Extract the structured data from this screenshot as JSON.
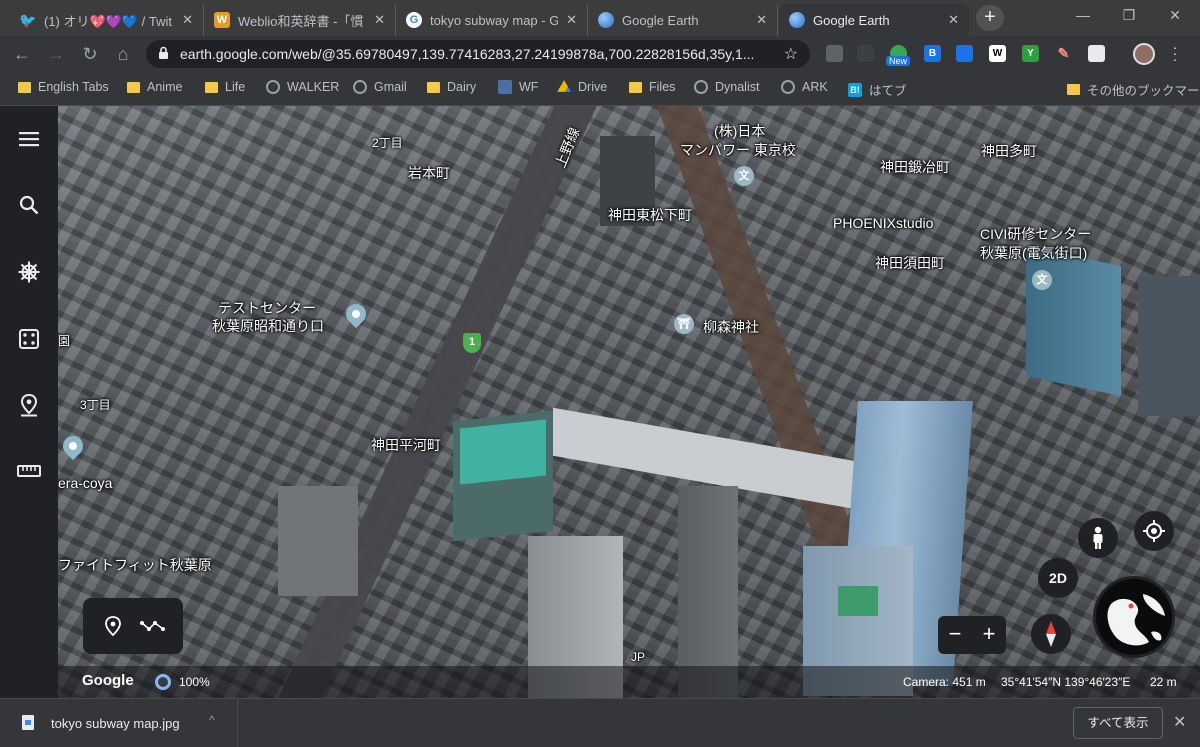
{
  "tabs": [
    {
      "title": "(1) オリ💖💜💙 / Twit",
      "favicon": "twitter-icon",
      "color": "#1da1f2",
      "glyph": "🐦"
    },
    {
      "title": "Weblio和英辞書 -「慣",
      "favicon": "weblio-icon",
      "color": "#e69a28",
      "glyph": "W"
    },
    {
      "title": "tokyo subway map - G",
      "favicon": "google-icon",
      "color": "#ffffff",
      "glyph": "G"
    },
    {
      "title": "Google Earth",
      "favicon": "google-earth-icon",
      "color": "#4a8bd6",
      "glyph": ""
    },
    {
      "title": "Google Earth",
      "favicon": "google-earth-icon",
      "color": "#4a8bd6",
      "glyph": "",
      "active": true
    }
  ],
  "tab_close": "✕",
  "new_tab": "+",
  "window_controls": {
    "minimize": "—",
    "maximize": "❐",
    "close": "✕"
  },
  "toolbar": {
    "back": "←",
    "forward": "→",
    "reload": "↻",
    "home": "⌂",
    "url": "earth.google.com/web/@35.69780497,139.77416283,27.24199878a,700.22828156d,35y,1...",
    "star": "☆",
    "new_badge": "New",
    "ext_b": "B",
    "ext_w": "W",
    "ext_y": "Y"
  },
  "bookmarks": [
    {
      "label": "English Tabs",
      "icon": "folder"
    },
    {
      "label": "Anime",
      "icon": "folder"
    },
    {
      "label": "Life",
      "icon": "folder"
    },
    {
      "label": "WALKER",
      "icon": "globe"
    },
    {
      "label": "Gmail",
      "icon": "globe"
    },
    {
      "label": "Dairy",
      "icon": "folder"
    },
    {
      "label": "WF",
      "icon": "wf"
    },
    {
      "label": "Drive",
      "icon": "drive"
    },
    {
      "label": "Files",
      "icon": "folder"
    },
    {
      "label": "Dynalist",
      "icon": "globe"
    },
    {
      "label": "ARK",
      "icon": "globe"
    },
    {
      "label": "はてブ",
      "icon": "hatena"
    },
    {
      "label": "その他のブックマーク",
      "icon": "folder"
    }
  ],
  "map_labels": [
    "2丁目",
    "岩本町",
    "上野線",
    "(株)日本",
    "マンパワー 東京校",
    "神田鍛冶町",
    "神田多町",
    "神田東松下町",
    "PHOENIXstudio",
    "CIVI研修センター",
    "秋葉原(電気街口)",
    "神田須田町",
    "テストセンター",
    "秋葉原昭和通り口",
    "柳森神社",
    "3丁目",
    "神田平河町",
    "era-coya",
    "ファイトフィット秋葉原",
    "園",
    "文",
    "1",
    "JP"
  ],
  "controls": {
    "two_d": "2D",
    "zoom_out": "−",
    "zoom_in": "+"
  },
  "infobar": {
    "brand": "Google",
    "load_percent": "100%",
    "camera": "Camera: 451 m",
    "coordinates": "35°41′54″N 139°46′23″E",
    "elevation": "22 m"
  },
  "download": {
    "filename": "tokyo subway map.jpg",
    "caret": "^",
    "show_all": "すべて表示",
    "close": "✕"
  }
}
